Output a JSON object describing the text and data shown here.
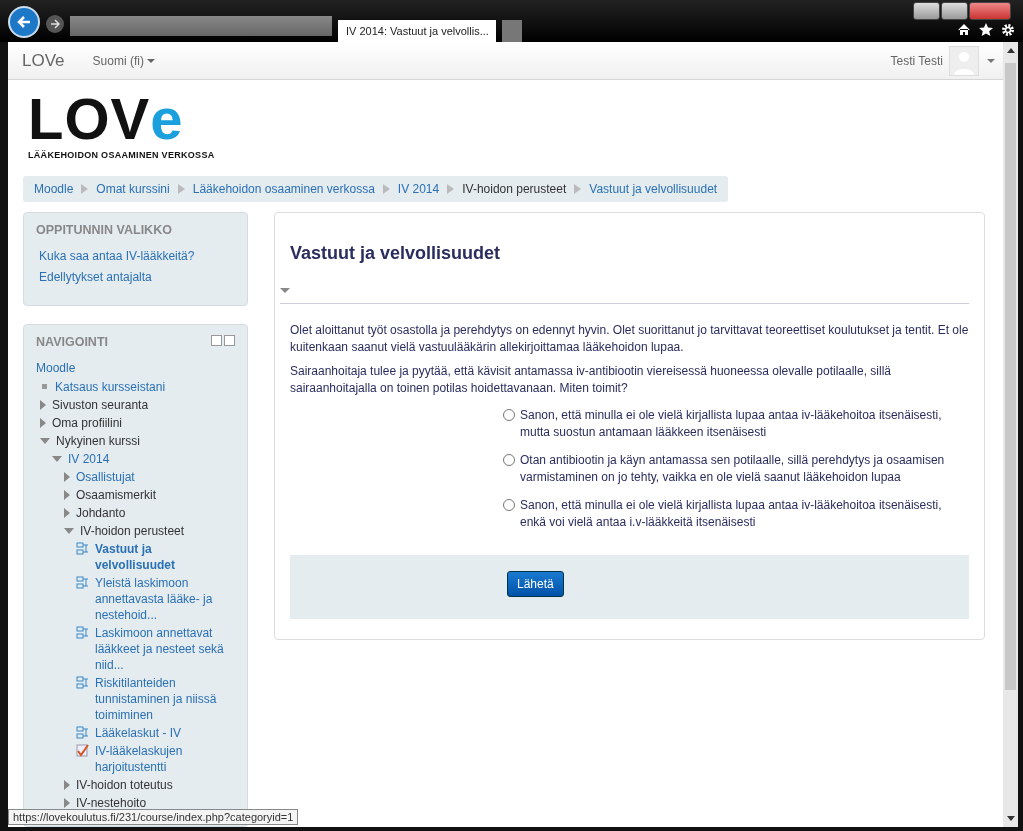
{
  "browser": {
    "tab_title": "IV 2014: Vastuut ja velvollis...",
    "status_url": "https://lovekoulutus.fi/231/course/index.php?categoryid=1"
  },
  "navbar": {
    "brand": "LOVe",
    "language": "Suomi (fi)",
    "user": "Testi Testi"
  },
  "logo": {
    "letters": "LOV",
    "accent": "e",
    "tagline": "LÄÄKEHOIDON OSAAMINEN VERKOSSA"
  },
  "breadcrumb": [
    {
      "label": "Moodle",
      "link": true
    },
    {
      "label": "Omat kurssini",
      "link": true
    },
    {
      "label": "Lääkehoidon osaaminen verkossa",
      "link": true
    },
    {
      "label": "IV 2014",
      "link": true
    },
    {
      "label": "IV-hoidon perusteet",
      "link": false
    },
    {
      "label": "Vastuut ja velvollisuudet",
      "link": true
    }
  ],
  "lesson_menu": {
    "title": "OPPITUNNIN VALIKKO",
    "items": [
      "Kuka saa antaa IV-lääkkeitä?",
      "Edellytykset antajalta"
    ]
  },
  "navigation": {
    "title": "NAVIGOINTI",
    "root": "Moodle",
    "items": [
      {
        "label": "Katsaus kursseistani",
        "kind": "bullet",
        "link": true,
        "current": false
      },
      {
        "label": "Sivuston seuranta",
        "kind": "branch",
        "expanded": false,
        "link": false,
        "current": false
      },
      {
        "label": "Oma profiilini",
        "kind": "branch",
        "expanded": false,
        "link": false,
        "current": false
      },
      {
        "label": "Nykyinen kurssi",
        "kind": "branch",
        "expanded": true,
        "link": false,
        "current": false,
        "children": [
          {
            "label": "IV 2014",
            "kind": "branch",
            "expanded": true,
            "link": true,
            "current": false,
            "children": [
              {
                "label": "Osallistujat",
                "kind": "branch",
                "expanded": false,
                "link": true,
                "current": false
              },
              {
                "label": "Osaamismerkit",
                "kind": "branch",
                "expanded": false,
                "link": false,
                "current": false
              },
              {
                "label": "Johdanto",
                "kind": "branch",
                "expanded": false,
                "link": false,
                "current": false
              },
              {
                "label": "IV-hoidon perusteet",
                "kind": "branch",
                "expanded": true,
                "link": false,
                "current": false,
                "children": [
                  {
                    "label": "Vastuut ja velvollisuudet",
                    "kind": "lesson",
                    "link": true,
                    "current": true
                  },
                  {
                    "label": "Yleistä laskimoon annettavasta lääke- ja nestehoid...",
                    "kind": "lesson",
                    "link": true,
                    "current": false
                  },
                  {
                    "label": "Laskimoon annettavat lääkkeet ja nesteet sekä niid...",
                    "kind": "lesson",
                    "link": true,
                    "current": false
                  },
                  {
                    "label": "Riskitilanteiden tunnistaminen ja niissä toimiminen",
                    "kind": "lesson",
                    "link": true,
                    "current": false
                  },
                  {
                    "label": "Lääkelaskut - IV",
                    "kind": "lesson",
                    "link": true,
                    "current": false
                  },
                  {
                    "label": "IV-lääkelaskujen harjoitustentti",
                    "kind": "quiz",
                    "link": true,
                    "current": false
                  }
                ]
              },
              {
                "label": "IV-hoidon toteutus",
                "kind": "branch",
                "expanded": false,
                "link": false,
                "current": false
              },
              {
                "label": "IV-nestehoito",
                "kind": "branch",
                "expanded": false,
                "link": false,
                "current": false
              }
            ]
          }
        ]
      }
    ]
  },
  "content": {
    "title": "Vastuut ja velvollisuudet",
    "paragraphs": [
      "Olet aloittanut työt osastolla ja perehdytys on edennyt hyvin. Olet suorittanut jo tarvittavat teoreettiset koulutukset ja tentit. Et ole kuitenkaan saanut vielä vastuulääkärin allekirjoittamaa lääkehoidon lupaa.",
      "Sairaanhoitaja tulee ja pyytää, että kävisit antamassa iv-antibiootin viereisessä huoneessa olevalle potilaalle, sillä sairaanhoitajalla on toinen potilas hoidettavanaan. Miten toimit?"
    ],
    "options": [
      {
        "label": "Sanon, että minulla ei ole vielä kirjallista lupaa antaa iv-lääkehoitoa itsenäisesti, mutta suostun antamaan lääkkeen itsenäisesti",
        "selected": false
      },
      {
        "label": "Otan antibiootin ja käyn antamassa sen potilaalle, sillä perehdytys ja osaamisen varmistaminen on jo tehty, vaikka en ole vielä saanut lääkehoidon lupaa",
        "selected": false
      },
      {
        "label": "Sanon, että minulla ei ole vielä kirjallista lupaa antaa iv-lääkehoitoa itsenäisesti, enkä voi vielä antaa i.v-lääkkeitä itsenäisesti",
        "selected": false
      }
    ],
    "submit": "Lähetä"
  }
}
